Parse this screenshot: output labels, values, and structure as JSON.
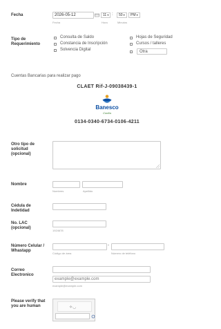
{
  "fecha": {
    "label": "Fecha",
    "date_value": "2026-05-12",
    "date_sub": "Fecha",
    "hour_value": "11",
    "minute_value": "50",
    "ampm_value": "PM",
    "hour_sub": "Hora",
    "minute_sub": "Minutos"
  },
  "tipo": {
    "label_line1": "Tipo de",
    "label_line2": "Requerimiento",
    "options_left": [
      "Consulta de Saldo",
      "Constancia de Inscripción",
      "Solvencia Digital"
    ],
    "options_right": [
      "Hojas de Seguridad",
      "Cursos / talleres"
    ],
    "otra_value": "Otra"
  },
  "cuentas": {
    "intro": "Cuentas Bancarias para realizar pago",
    "company": "CLAET Rif-J-09038439-1",
    "bank_logo_text": "Banesco",
    "bank_logo_sub": "Confía",
    "account": "0134-0340-6734-0106-4211"
  },
  "otro_tipo": {
    "label_line1": "Otro tipo de",
    "label_line2": "solicitud",
    "label_line3": "(opcional)"
  },
  "nombre": {
    "label": "Nombre",
    "first_sub": "Nombres",
    "last_sub": "Apellido"
  },
  "cedula": {
    "label_line1": "Cédula de",
    "label_line2": "Indetidad"
  },
  "lac": {
    "label_line1": "No. LAC",
    "label_line2": "(opcional)",
    "sub": "1924678"
  },
  "celular": {
    "label_line1": "Número Celular /",
    "label_line2": "Whastapp",
    "area_sub": "Código de área",
    "phone_sub": "Número de teléfono",
    "dash": "-"
  },
  "correo": {
    "label_line1": "Correo",
    "label_line2": "Electronico",
    "confirm_placeholder": "example@example.com",
    "sub": "example@example.com"
  },
  "captcha": {
    "label_line1": "Please verify that",
    "label_line2": "you are human"
  }
}
